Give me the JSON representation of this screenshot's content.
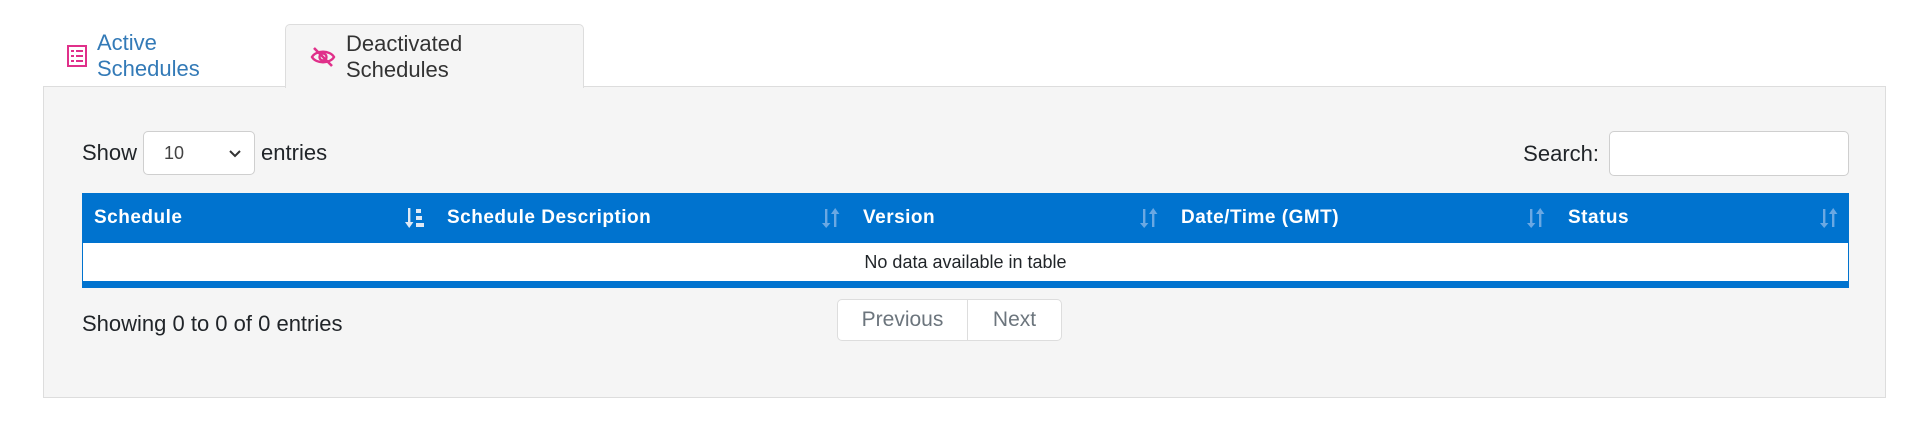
{
  "tabs": {
    "active_label": "Active Schedules",
    "deactivated_label": "Deactivated Schedules"
  },
  "length": {
    "show_label": "Show",
    "value": "10",
    "entries_label": "entries"
  },
  "search": {
    "label": "Search:",
    "value": ""
  },
  "table": {
    "columns": [
      "Schedule",
      "Schedule Description",
      "Version",
      "Date/Time (GMT)",
      "Status"
    ],
    "empty_message": "No data available in table"
  },
  "footer": {
    "info": "Showing 0 to 0 of 0 entries",
    "prev_label": "Previous",
    "next_label": "Next"
  },
  "colors": {
    "header_bg": "#0073cf",
    "tab_active_text": "#337ab7",
    "icon_pink": "#e0308a"
  }
}
